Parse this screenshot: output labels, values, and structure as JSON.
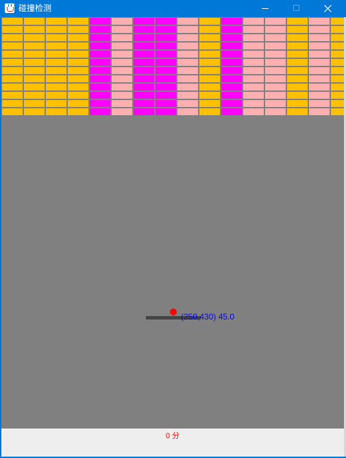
{
  "window": {
    "title": "碰撞检测",
    "icon": "java-cup-icon",
    "controls": [
      "minimize-icon",
      "maximize-icon",
      "close-icon"
    ]
  },
  "game": {
    "background": "#808080",
    "brick_rows": 12,
    "brick_columns": [
      "#ffc000",
      "#ffc000",
      "#ffc000",
      "#ffc000",
      "#ff00ff",
      "#ffafaf",
      "#ff00ff",
      "#ff00ff",
      "#ffafaf",
      "#ffc000",
      "#ff00ff",
      "#ffafaf",
      "#ffafaf",
      "#ffc000",
      "#ffafaf",
      "#ffc000"
    ],
    "paddle_color": "#444444",
    "ball_color": "#ff0000",
    "readout": "(250,430) 45.0"
  },
  "status": {
    "score": "0 分"
  }
}
